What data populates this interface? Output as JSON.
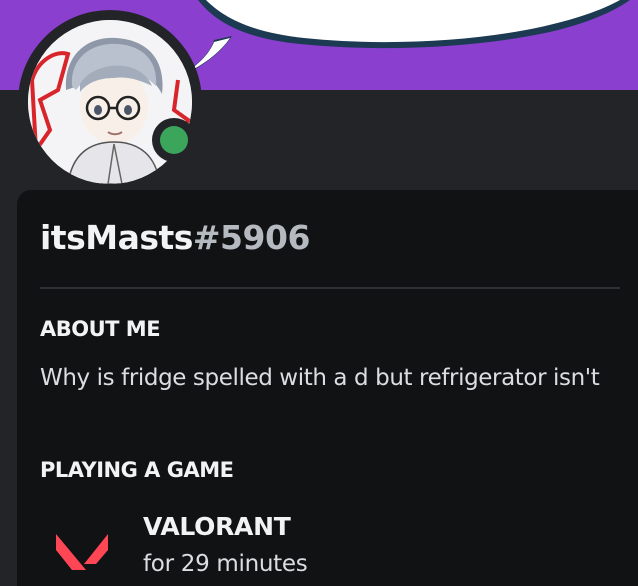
{
  "profile": {
    "username": "itsMasts",
    "discriminator": "#5906",
    "status": "online",
    "banner_color": "#8a3fcf"
  },
  "about_me": {
    "title": "ABOUT ME",
    "text": "Why is fridge spelled with a d but refrigerator isn't"
  },
  "activity": {
    "title": "PLAYING A GAME",
    "game_name": "VALORANT",
    "elapsed": "for 29 minutes",
    "icon": "valorant-icon"
  },
  "colors": {
    "online": "#3ba55c",
    "card_bg": "#111214",
    "text_primary": "#f2f3f5",
    "text_secondary": "#dbdee1"
  }
}
